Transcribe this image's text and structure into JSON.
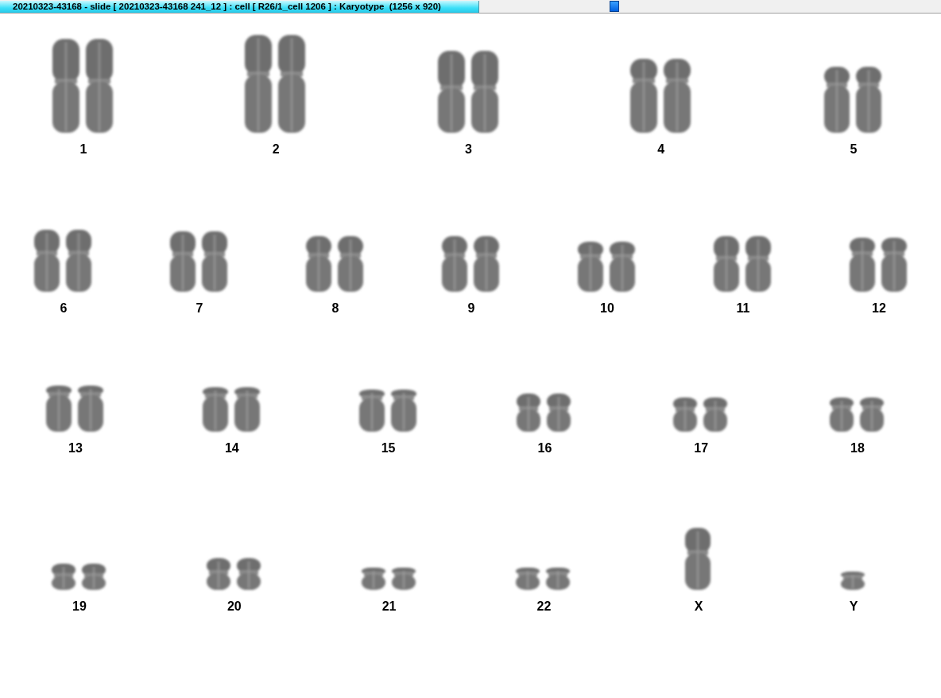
{
  "window": {
    "title": "20210323-43168 - slide [ 20210323-43168 241_12 ] : cell [ R26/1_cell 1206 ] : Karyotype  (1256 x 920)"
  },
  "karyotype": {
    "chromosomes": [
      {
        "label": "1",
        "kind": "pair"
      },
      {
        "label": "2",
        "kind": "pair"
      },
      {
        "label": "3",
        "kind": "pair"
      },
      {
        "label": "4",
        "kind": "pair"
      },
      {
        "label": "5",
        "kind": "pair"
      },
      {
        "label": "6",
        "kind": "pair"
      },
      {
        "label": "7",
        "kind": "pair"
      },
      {
        "label": "8",
        "kind": "pair"
      },
      {
        "label": "9",
        "kind": "pair"
      },
      {
        "label": "10",
        "kind": "pair"
      },
      {
        "label": "11",
        "kind": "pair"
      },
      {
        "label": "12",
        "kind": "pair"
      },
      {
        "label": "13",
        "kind": "pair"
      },
      {
        "label": "14",
        "kind": "pair"
      },
      {
        "label": "15",
        "kind": "pair"
      },
      {
        "label": "16",
        "kind": "pair"
      },
      {
        "label": "17",
        "kind": "pair"
      },
      {
        "label": "18",
        "kind": "pair"
      },
      {
        "label": "19",
        "kind": "pair"
      },
      {
        "label": "20",
        "kind": "pair"
      },
      {
        "label": "21",
        "kind": "pair"
      },
      {
        "label": "22",
        "kind": "pair"
      },
      {
        "label": "X",
        "kind": "single"
      },
      {
        "label": "Y",
        "kind": "single"
      }
    ]
  }
}
